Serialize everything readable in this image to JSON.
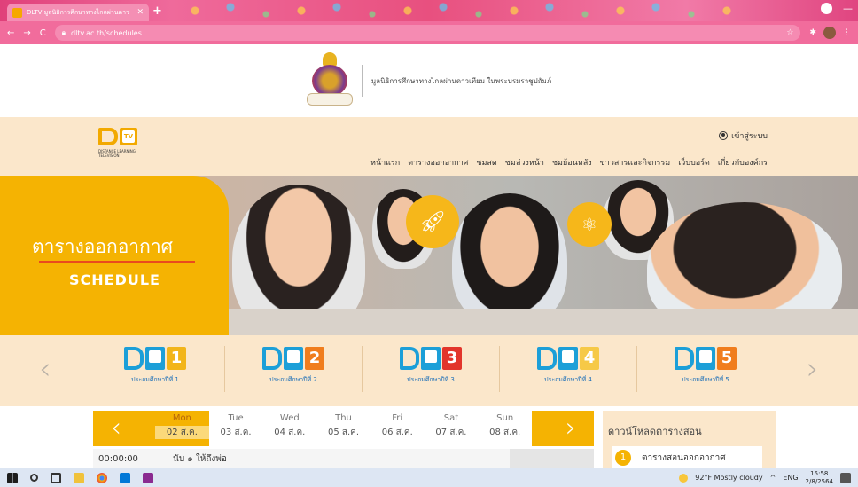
{
  "browser": {
    "tab_title": "DLTV มูลนิธิการศึกษาทางไกลผ่านดาว",
    "url": "dltv.ac.th/schedules"
  },
  "foundation": {
    "text": "มูลนิธิการศึกษาทางไกลผ่านดาวเทียม ในพระบรมราชูปถัมภ์"
  },
  "site": {
    "logo_tagline": "DISTANCE LEARNING TELEVISION",
    "login_label": "เข้าสู่ระบบ",
    "nav": [
      "หน้าแรก",
      "ตารางออกอากาศ",
      "ชมสด",
      "ชมล่วงหน้า",
      "ชมย้อนหลัง",
      "ข่าวสารและกิจกรรม",
      "เว็บบอร์ด",
      "เกี่ยวกับองค์กร"
    ]
  },
  "hero": {
    "title_th": "ตารางออกอากาศ",
    "title_en": "SCHEDULE"
  },
  "grades": [
    {
      "num": "1",
      "label": "ประถมศึกษาปีที่ 1",
      "color": "#f2b51a"
    },
    {
      "num": "2",
      "label": "ประถมศึกษาปีที่ 2",
      "color": "#f07d1d"
    },
    {
      "num": "3",
      "label": "ประถมศึกษาปีที่ 3",
      "color": "#e2352b"
    },
    {
      "num": "4",
      "label": "ประถมศึกษาปีที่ 4",
      "color": "#f6c947"
    },
    {
      "num": "5",
      "label": "ประถมศึกษาปีที่ 5",
      "color": "#f07d1d"
    }
  ],
  "schedule": {
    "days": [
      {
        "name": "Mon",
        "date": "02 ส.ค."
      },
      {
        "name": "Tue",
        "date": "03 ส.ค."
      },
      {
        "name": "Wed",
        "date": "04 ส.ค."
      },
      {
        "name": "Thu",
        "date": "05 ส.ค."
      },
      {
        "name": "Fri",
        "date": "06 ส.ค."
      },
      {
        "name": "Sat",
        "date": "07 ส.ค."
      },
      {
        "name": "Sun",
        "date": "08 ส.ค."
      }
    ],
    "active_day_index": 0,
    "row": {
      "time": "00:00:00",
      "program": "นับ ๑ ให้ถึงพ่อ"
    }
  },
  "download": {
    "title": "ดาวน์โหลดตารางสอน",
    "item_num": "1",
    "item_label": "ตารางสอนออกอากาศ"
  },
  "taskbar": {
    "weather": "92°F Mostly cloudy",
    "lang": "ENG",
    "time": "15:58",
    "date": "2/8/2564"
  },
  "colors": {
    "brand_orange": "#f5b302",
    "brand_blue": "#1c9fd8",
    "header_bg": "#fbe7cb"
  }
}
